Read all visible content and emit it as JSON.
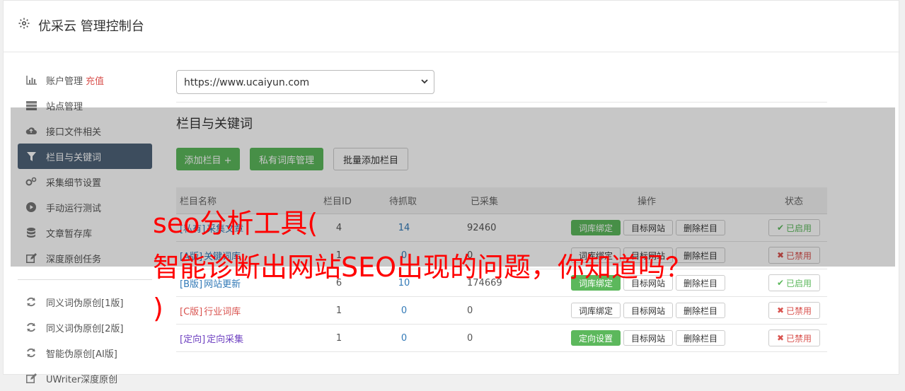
{
  "header": {
    "title": "优采云 管理控制台"
  },
  "sidebar": {
    "items": [
      {
        "label": "账户管理",
        "extra": "充值",
        "icon": "bar-chart-icon"
      },
      {
        "label": "站点管理",
        "icon": "server-icon"
      },
      {
        "label": "接口文件相关",
        "icon": "cloud-upload-icon"
      },
      {
        "label": "栏目与关键词",
        "icon": "filter-icon",
        "active": true
      },
      {
        "label": "采集细节设置",
        "icon": "cogs-icon"
      },
      {
        "label": "手动运行测试",
        "icon": "play-circle-icon"
      },
      {
        "label": "文章暂存库",
        "icon": "database-icon"
      },
      {
        "label": "深度原创任务",
        "icon": "edit-icon"
      }
    ],
    "items2": [
      {
        "label": "同义词伪原创[1版]",
        "icon": "refresh-icon"
      },
      {
        "label": "同义词伪原创[2版]",
        "icon": "refresh-icon"
      },
      {
        "label": "智能伪原创[AI版]",
        "icon": "refresh-icon"
      },
      {
        "label": "UWriter深度原创",
        "icon": "edit-icon"
      }
    ]
  },
  "site_select": {
    "value": "https://www.ucaiyun.com"
  },
  "section_title": "栏目与关键词",
  "toolbar": {
    "add_label": "添加栏目 +",
    "private_label": "私有词库管理",
    "batch_label": "批量添加栏目"
  },
  "table": {
    "headers": [
      "栏目名称",
      "栏目ID",
      "待抓取",
      "已采集",
      "操作",
      "状态"
    ],
    "rows": [
      {
        "prefix": "[私有]",
        "name": "采集文章",
        "id": "4",
        "pending": "14",
        "collected": "92460",
        "action1": "词库绑定",
        "action1_style": "green",
        "action2": "目标网站",
        "action3": "删除栏目",
        "status": "已启用",
        "status_on": true
      },
      {
        "prefix": "[A版]",
        "name": "关键词库",
        "id": "1",
        "pending": "0",
        "collected": "0",
        "action1": "词库绑定",
        "action1_style": "default",
        "action2": "目标网站",
        "action3": "删除栏目",
        "status": "已禁用",
        "status_on": false
      },
      {
        "prefix": "[B版]",
        "name": "网站更新",
        "id": "6",
        "pending": "10",
        "collected": "174669",
        "action1": "词库绑定",
        "action1_style": "green",
        "action2": "目标网站",
        "action3": "删除栏目",
        "status": "已启用",
        "status_on": true
      },
      {
        "prefix": "[C版]",
        "name": "行业词库",
        "id": "1",
        "pending": "0",
        "collected": "0",
        "action1": "词库绑定",
        "action1_style": "default",
        "action2": "目标网站",
        "action3": "删除栏目",
        "status": "已禁用",
        "status_on": false
      },
      {
        "prefix": "[定向]",
        "name": "定向采集",
        "id": "1",
        "pending": "0",
        "collected": "0",
        "action1": "定向设置",
        "action1_style": "green",
        "action2": "目标网站",
        "action3": "删除栏目",
        "status": "已禁用",
        "status_on": false
      }
    ]
  },
  "overlay_text": {
    "line1": "seo分析工具(",
    "line2": "智能诊断出网站SEO出现的问题，你知道吗？",
    "line3": ")"
  },
  "colors": {
    "active_bg": "#4f6379",
    "green": "#5cb85c",
    "red": "#d9534f",
    "overlay_text": "#ff0000"
  }
}
